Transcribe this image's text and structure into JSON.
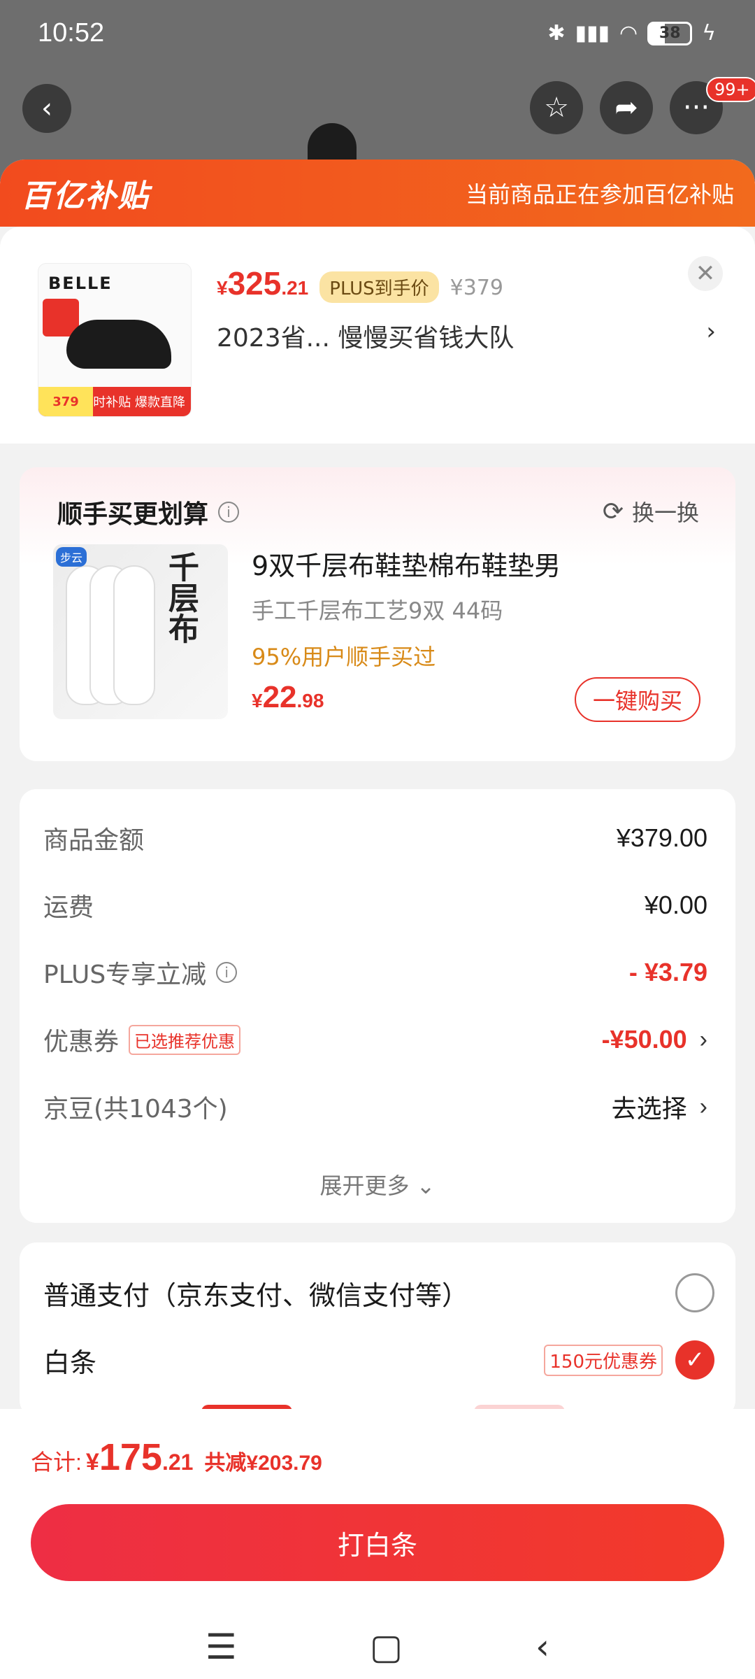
{
  "status": {
    "time": "10:52",
    "battery": "38"
  },
  "nav": {
    "back_icon": "back-arrow-icon",
    "badge": "99+"
  },
  "subsidy": {
    "logo": "百亿补贴",
    "note": "当前商品正在参加百亿补贴"
  },
  "product": {
    "thumb_brand": "BELLE",
    "thumb_price": "379",
    "thumb_strip": "限时补贴 爆款直降",
    "price_currency": "¥",
    "price_int": "325",
    "price_dec": ".21",
    "plus_label": "PLUS到手价",
    "orig_price": "¥379",
    "title": "2023省...  慢慢买省钱大队"
  },
  "addon": {
    "title": "顺手买更划算",
    "refresh_label": "换一换",
    "thumb_brand": "步云",
    "thumb_text": "千层布",
    "name": "9双千层布鞋垫棉布鞋垫男",
    "spec": "手工千层布工艺9双   44码",
    "social": "95%用户顺手买过",
    "price_currency": "¥",
    "price_int": "22",
    "price_dec": ".98",
    "buy_label": "一键购买"
  },
  "costs": {
    "goods": {
      "label": "商品金额",
      "value": "¥379.00"
    },
    "shipping": {
      "label": "运费",
      "value": "¥0.00"
    },
    "plus": {
      "label": "PLUS专享立减",
      "value": "- ¥3.79"
    },
    "coupon": {
      "label": "优惠券",
      "tag": "已选推荐优惠",
      "value": "-¥50.00"
    },
    "jingdou": {
      "label": "京豆(共1043个)",
      "value": "去选择"
    },
    "expand": "展开更多 ⌄"
  },
  "payment": {
    "normal_label": "普通支付（京东支付、微信支付等）",
    "baitiao_label": "白条",
    "baitiao_coupon": "150元优惠券"
  },
  "total": {
    "label": "合计:",
    "currency": "¥",
    "int": "175",
    "dec": ".21",
    "saved": "共减¥203.79"
  },
  "pay_button": "打白条",
  "colors": {
    "accent": "#e8322a",
    "subsidy": "#f24b1e",
    "plus_badge": "#fbe3a3"
  }
}
